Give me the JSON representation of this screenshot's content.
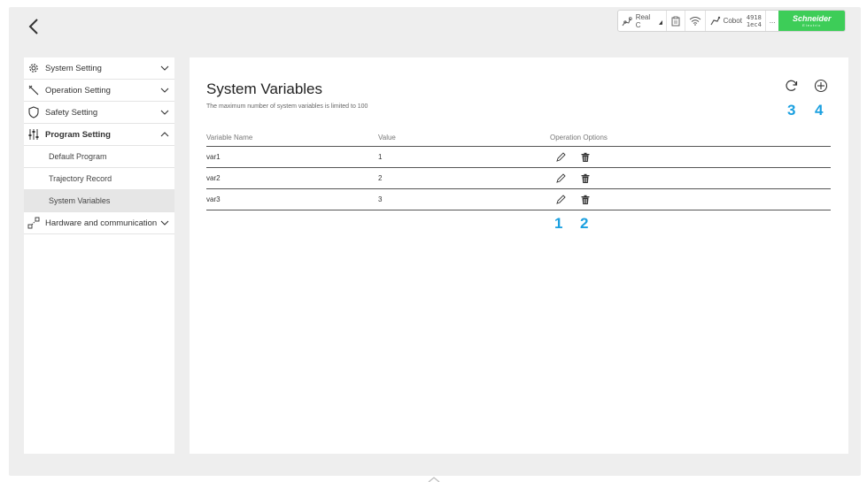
{
  "statusbar": {
    "mode_label": "Real C",
    "robot_label": "Cobot",
    "robot_id_line1": "4918",
    "robot_id_line2": "1ec4",
    "more_label": "...",
    "brand_name": "Schneider",
    "brand_sub": "Electric",
    "brand_color": "#3dcd58"
  },
  "sidebar": {
    "items": [
      {
        "label": "System Setting",
        "icon": "gear-icon"
      },
      {
        "label": "Operation Setting",
        "icon": "wrench-icon"
      },
      {
        "label": "Safety Setting",
        "icon": "shield-icon"
      },
      {
        "label": "Program Setting",
        "icon": "sliders-icon",
        "expanded": true
      },
      {
        "label": "Hardware and communication",
        "icon": "network-icon"
      }
    ],
    "subitems": [
      {
        "label": "Default Program"
      },
      {
        "label": "Trajectory Record"
      },
      {
        "label": "System Variables",
        "active": true
      }
    ]
  },
  "main": {
    "title": "System Variables",
    "subtitle": "The maximum number of system variables is limited to 100",
    "columns": [
      "Variable Name",
      "Value",
      "Operation Options"
    ],
    "rows": [
      {
        "name": "var1",
        "value": "1"
      },
      {
        "name": "var2",
        "value": "2"
      },
      {
        "name": "var3",
        "value": "3"
      }
    ],
    "markers": {
      "edit": "1",
      "delete": "2",
      "refresh": "3",
      "add": "4"
    },
    "marker_color": "#1ba0e0"
  }
}
